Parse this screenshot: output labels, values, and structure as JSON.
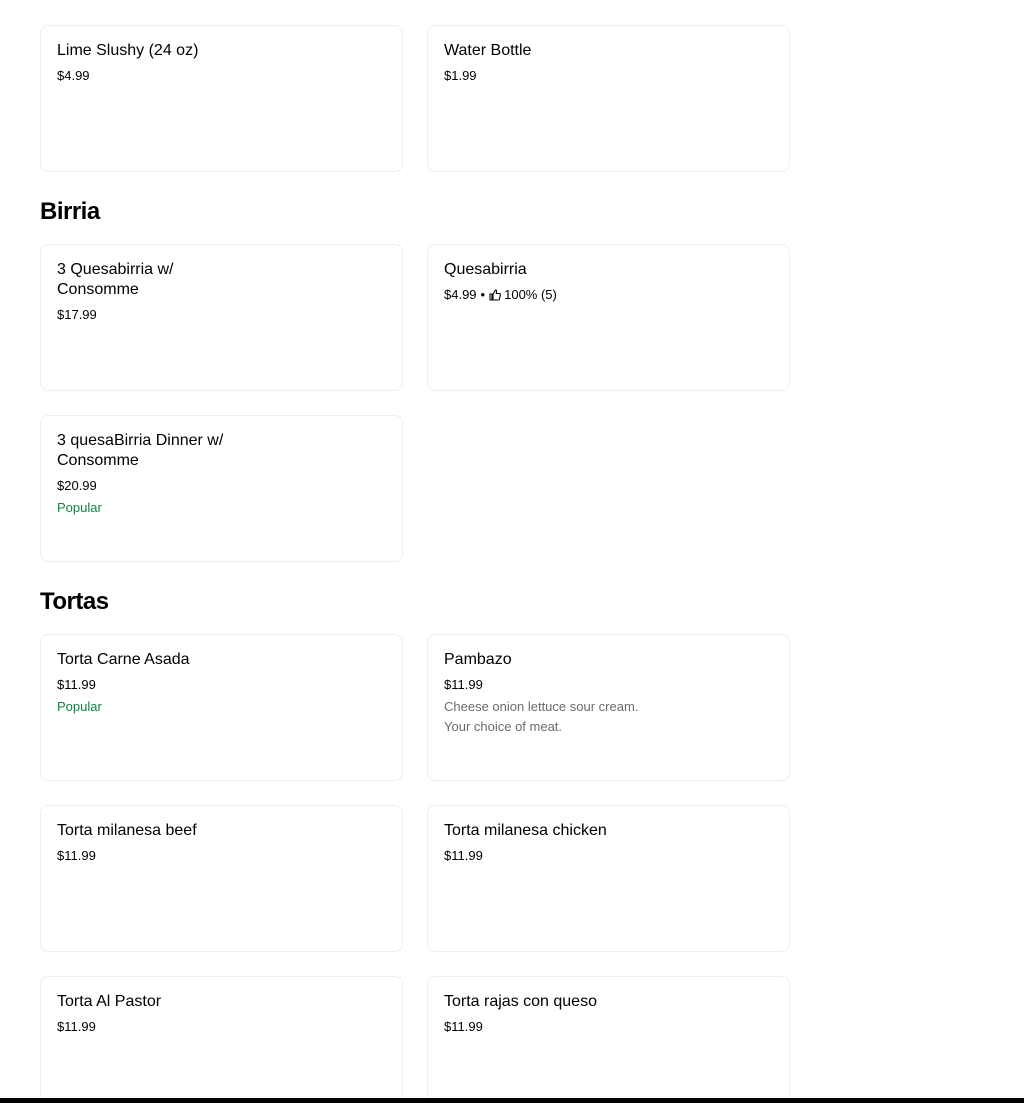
{
  "drinks": {
    "items": [
      {
        "name": "Lime Slushy (24 oz)",
        "price": "$4.99"
      },
      {
        "name": "Water Bottle",
        "price": "$1.99"
      }
    ]
  },
  "birria": {
    "title": "Birria",
    "items": [
      {
        "name": "3 Quesabirria w/ Consomme",
        "price": "$17.99"
      },
      {
        "name": "Quesabirria",
        "price": "$4.99",
        "separator": "•",
        "rating": "100% (5)"
      },
      {
        "name": "3 quesaBirria Dinner w/ Consomme",
        "price": "$20.99",
        "badge": "Popular"
      }
    ]
  },
  "tortas": {
    "title": "Tortas",
    "items": [
      {
        "name": "Torta Carne Asada",
        "price": "$11.99",
        "badge": "Popular"
      },
      {
        "name": "Pambazo",
        "price": "$11.99",
        "description": "Cheese onion lettuce sour cream. Your choice of meat."
      },
      {
        "name": "Torta milanesa beef",
        "price": "$11.99"
      },
      {
        "name": "Torta milanesa chicken",
        "price": "$11.99"
      },
      {
        "name": "Torta Al Pastor",
        "price": "$11.99"
      },
      {
        "name": "Torta rajas con queso",
        "price": "$11.99"
      }
    ]
  },
  "colors": {
    "popular": "#0e8345",
    "description": "#6b6b6b",
    "border": "#eeeeee"
  }
}
